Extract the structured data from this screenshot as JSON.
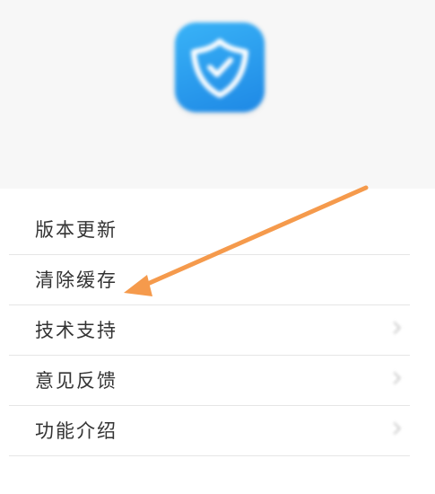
{
  "header": {
    "app_name": "",
    "app_version": "",
    "icon": "shield-check-icon",
    "icon_colors": [
      "#39b3f7",
      "#1e88e5"
    ]
  },
  "menu": {
    "items": [
      {
        "label": "版本更新",
        "value": "",
        "has_chevron": false
      },
      {
        "label": "清除缓存",
        "value": "",
        "has_chevron": false
      },
      {
        "label": "技术支持",
        "value": "",
        "has_chevron": true
      },
      {
        "label": "意见反馈",
        "value": "",
        "has_chevron": true
      },
      {
        "label": "功能介绍",
        "value": "",
        "has_chevron": true
      }
    ]
  },
  "annotation": {
    "icon": "arrow-icon",
    "color": "#f59a4c",
    "target": "清除缓存"
  }
}
